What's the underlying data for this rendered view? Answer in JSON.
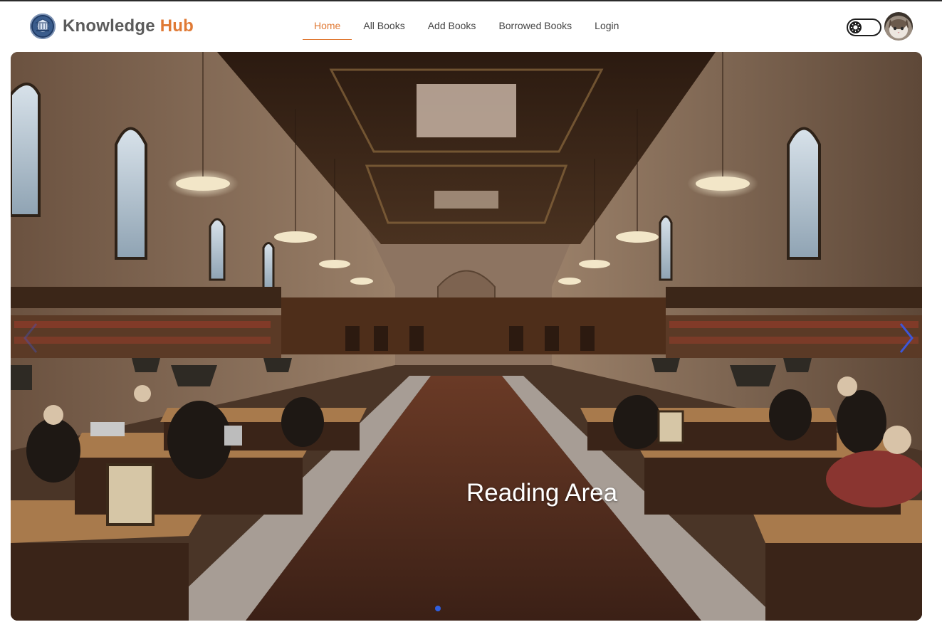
{
  "brand": {
    "part1": "Knowledge",
    "part2": "Hub"
  },
  "nav": {
    "items": [
      {
        "label": "Home",
        "active": true
      },
      {
        "label": "All Books",
        "active": false
      },
      {
        "label": "Add Books",
        "active": false
      },
      {
        "label": "Borrowed Books",
        "active": false
      },
      {
        "label": "Login",
        "active": false
      }
    ]
  },
  "theme_toggle": {
    "icon": "sun-icon",
    "state": "light"
  },
  "user": {
    "avatar": "cat-avatar"
  },
  "carousel": {
    "slide_caption": "Reading Area",
    "slide_count": 1,
    "active_index": 0
  },
  "colors": {
    "accent": "#e07a35",
    "brand_dark": "#5b5b5b",
    "dot_active": "#2f5fe0",
    "arrow": "#3d56d8"
  }
}
